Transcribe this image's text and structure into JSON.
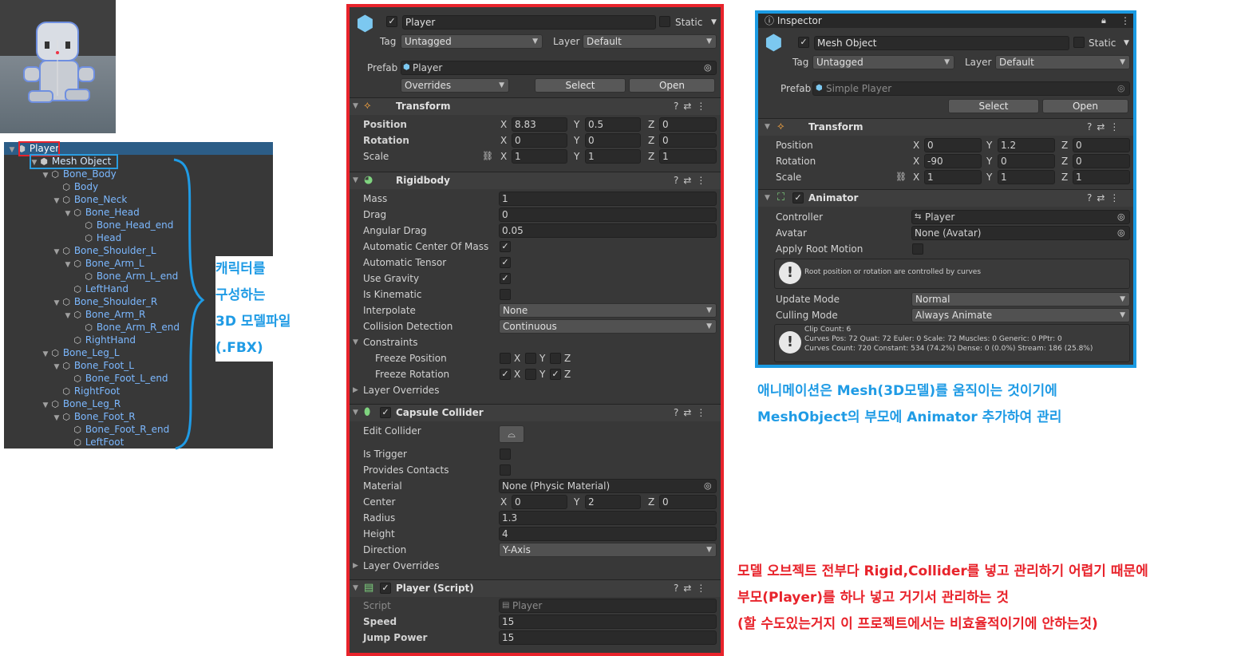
{
  "hierarchy": {
    "items": [
      {
        "label": "Player"
      },
      {
        "label": "Mesh Object"
      },
      {
        "label": "Bone_Body"
      },
      {
        "label": "Body"
      },
      {
        "label": "Bone_Neck"
      },
      {
        "label": "Bone_Head"
      },
      {
        "label": "Bone_Head_end"
      },
      {
        "label": "Head"
      },
      {
        "label": "Bone_Shoulder_L"
      },
      {
        "label": "Bone_Arm_L"
      },
      {
        "label": "Bone_Arm_L_end"
      },
      {
        "label": "LeftHand"
      },
      {
        "label": "Bone_Shoulder_R"
      },
      {
        "label": "Bone_Arm_R"
      },
      {
        "label": "Bone_Arm_R_end"
      },
      {
        "label": "RightHand"
      },
      {
        "label": "Bone_Leg_L"
      },
      {
        "label": "Bone_Foot_L"
      },
      {
        "label": "Bone_Foot_L_end"
      },
      {
        "label": "RightFoot"
      },
      {
        "label": "Bone_Leg_R"
      },
      {
        "label": "Bone_Foot_R"
      },
      {
        "label": "Bone_Foot_R_end"
      },
      {
        "label": "LeftFoot"
      }
    ]
  },
  "annotation_fbx": [
    "캐릭터를",
    "구성하는",
    "3D 모델파일",
    "(.FBX)"
  ],
  "player_inspector": {
    "name": "Player",
    "static_label": "Static",
    "tag_label": "Tag",
    "tag_value": "Untagged",
    "layer_label": "Layer",
    "layer_value": "Default",
    "prefab_label": "Prefab",
    "prefab_value": "Player",
    "overrides": "Overrides",
    "select": "Select",
    "open": "Open",
    "transform": {
      "title": "Transform",
      "position_label": "Position",
      "rotation_label": "Rotation",
      "scale_label": "Scale",
      "position": [
        "8.83",
        "0.5",
        "0"
      ],
      "rotation": [
        "0",
        "0",
        "0"
      ],
      "scale": [
        "1",
        "1",
        "1"
      ]
    },
    "rigidbody": {
      "title": "Rigidbody",
      "mass_label": "Mass",
      "mass": "1",
      "drag_label": "Drag",
      "drag": "0",
      "angular_drag_label": "Angular Drag",
      "angular_drag": "0.05",
      "auto_com_label": "Automatic Center Of Mass",
      "auto_tensor_label": "Automatic Tensor",
      "use_gravity_label": "Use Gravity",
      "is_kinematic_label": "Is Kinematic",
      "interpolate_label": "Interpolate",
      "interpolate": "None",
      "collision_label": "Collision Detection",
      "collision": "Continuous",
      "constraints_label": "Constraints",
      "freeze_pos_label": "Freeze Position",
      "freeze_rot_label": "Freeze Rotation",
      "layer_overrides_label": "Layer Overrides"
    },
    "capsule": {
      "title": "Capsule Collider",
      "edit_collider_label": "Edit Collider",
      "is_trigger_label": "Is Trigger",
      "provides_contacts_label": "Provides Contacts",
      "material_label": "Material",
      "material": "None (Physic Material)",
      "center_label": "Center",
      "center": [
        "0",
        "2",
        "0"
      ],
      "radius_label": "Radius",
      "radius": "1.3",
      "height_label": "Height",
      "height": "4",
      "direction_label": "Direction",
      "direction": "Y-Axis",
      "layer_overrides_label": "Layer Overrides"
    },
    "script": {
      "title": "Player (Script)",
      "script_label": "Script",
      "script": "Player",
      "speed_label": "Speed",
      "speed": "15",
      "jump_label": "Jump Power",
      "jump": "15"
    }
  },
  "mesh_inspector": {
    "tab": "Inspector",
    "name": "Mesh Object",
    "static_label": "Static",
    "tag_label": "Tag",
    "tag_value": "Untagged",
    "layer_label": "Layer",
    "layer_value": "Default",
    "prefab_label": "Prefab",
    "prefab_value": "Simple Player",
    "select": "Select",
    "open": "Open",
    "transform": {
      "title": "Transform",
      "position_label": "Position",
      "rotation_label": "Rotation",
      "scale_label": "Scale",
      "position": [
        "0",
        "1.2",
        "0"
      ],
      "rotation": [
        "-90",
        "0",
        "0"
      ],
      "scale": [
        "1",
        "1",
        "1"
      ]
    },
    "animator": {
      "title": "Animator",
      "controller_label": "Controller",
      "controller": "Player",
      "avatar_label": "Avatar",
      "avatar": "None (Avatar)",
      "root_motion_label": "Apply Root Motion",
      "info": "Root position or rotation are controlled by curves",
      "update_label": "Update Mode",
      "update": "Normal",
      "culling_label": "Culling Mode",
      "culling": "Always Animate",
      "stats": [
        "Clip Count: 6",
        "Curves Pos: 72 Quat: 72 Euler: 0 Scale: 72 Muscles: 0 Generic: 0 PPtr: 0",
        "Curves Count: 720 Constant: 534 (74.2%) Dense: 0 (0.0%) Stream: 186 (25.8%)"
      ]
    }
  },
  "axis": {
    "x": "X",
    "y": "Y",
    "z": "Z"
  },
  "blue_note": [
    "애니메이션은 Mesh(3D모델)를 움직이는 것이기에",
    "MeshObject의 부모에 Animator 추가하여 관리"
  ],
  "red_note": [
    "모델 오브젝트 전부다 Rigid,Collider를 넣고 관리하기 어렵기 때문에",
    "부모(Player)를 하나 넣고 거기서 관리하는 것",
    "(할 수도있는거지 이 프로젝트에서는 비효율적이기에 안하는것)"
  ],
  "colors": {
    "red": "#e8232b",
    "blue": "#1f9be5",
    "panel": "#383838"
  }
}
